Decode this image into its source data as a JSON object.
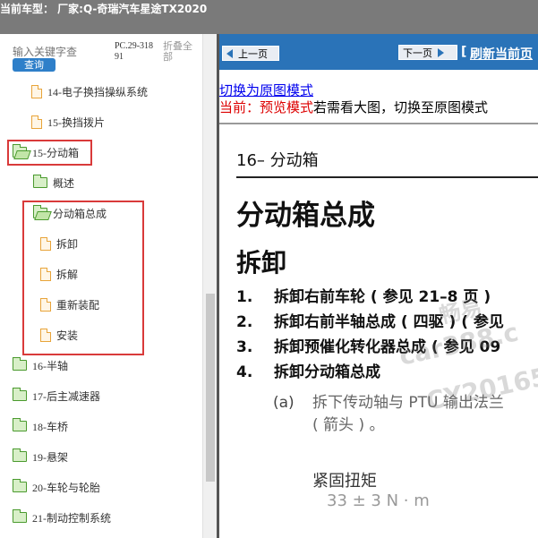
{
  "header": {
    "title": "当前车型：  厂家:Q-奇瑞汽车星途TX2020"
  },
  "sidebar": {
    "search": {
      "placeholder": "输入关键字查",
      "button_label": "查询",
      "code": "PC.29-31891",
      "collapse_all": "折叠全部"
    },
    "items": [
      {
        "label": "14-电子换挡操纵系统",
        "type": "doc"
      },
      {
        "label": "15-换挡拨片",
        "type": "doc"
      },
      {
        "label": "15-分动箱",
        "type": "folder-open"
      },
      {
        "label": "概述",
        "type": "folder"
      },
      {
        "label": "分动箱总成",
        "type": "folder-open"
      },
      {
        "label": "拆卸",
        "type": "doc"
      },
      {
        "label": "拆解",
        "type": "doc"
      },
      {
        "label": "重新装配",
        "type": "doc"
      },
      {
        "label": "安装",
        "type": "doc"
      },
      {
        "label": "16-半轴",
        "type": "folder"
      },
      {
        "label": "17-后主减速器",
        "type": "folder"
      },
      {
        "label": "18-车桥",
        "type": "folder"
      },
      {
        "label": "19-悬架",
        "type": "folder"
      },
      {
        "label": "20-车轮与轮胎",
        "type": "folder"
      },
      {
        "label": "21-制动控制系统",
        "type": "folder"
      }
    ]
  },
  "viewer": {
    "prev_label": "上一页",
    "next_label": "下一页",
    "refresh_label": "刷新当前页",
    "refresh_bracket": "[",
    "switch_link": "切换为原图模式",
    "mode_prefix": "当前：预览模式",
    "mode_suffix": "若需看大图，切换至原图模式"
  },
  "document": {
    "section": "16– 分动箱",
    "title": "分动箱总成",
    "subtitle": "拆卸",
    "steps": [
      {
        "num": "1.",
        "text": "拆卸右前车轮 ( 参见 21–8 页 )"
      },
      {
        "num": "2.",
        "text": "拆卸右前半轴总成 ( 四驱 ) ( 参见"
      },
      {
        "num": "3.",
        "text": "拆卸预催化转化器总成 ( 参见 09"
      },
      {
        "num": "4.",
        "text": "拆卸分动箱总成"
      }
    ],
    "substep_label": "(a)",
    "substep_line1": "拆下传动轴与 PTU 输出法兰",
    "substep_line2": "( 箭头 ) 。",
    "torque_label": "紧固扭矩",
    "torque_value": "33 ± 3 N · m"
  },
  "watermark": {
    "line1": "畅易",
    "line2": "car388.c",
    "line3": "CY20165"
  },
  "colors": {
    "header_bg": "#7a7a7a",
    "navbar_bg": "#2a73b8",
    "highlight": "#d93a3a",
    "search_button": "#2e7fc9"
  }
}
